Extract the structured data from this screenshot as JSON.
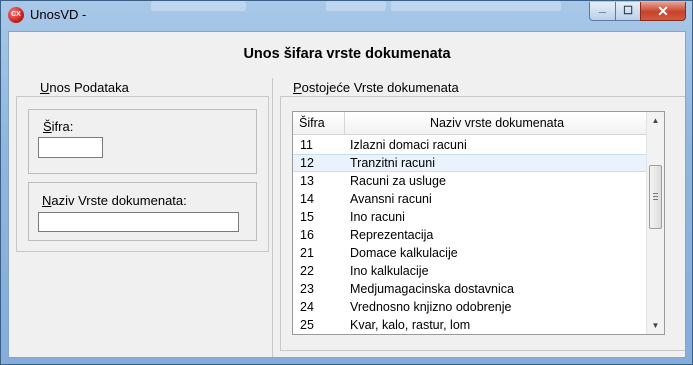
{
  "window": {
    "title": "UnosVD -",
    "icon": "cx-app-icon",
    "controls": {
      "minimize": "minimize-icon",
      "maximize": "maximize-icon",
      "close": "close-icon"
    }
  },
  "form": {
    "heading": "Unos šifara vrste dokumenata",
    "entry_group": {
      "legend_first": "U",
      "legend_rest": "nos Podataka",
      "sifra_label_first": "Š",
      "sifra_label_rest": "ifra:",
      "sifra_value": "",
      "naziv_label_first": "N",
      "naziv_label_rest": "aziv Vrste dokumenata:",
      "naziv_value": ""
    },
    "list_group": {
      "legend_first": "P",
      "legend_rest": "ostojeće Vrste dokumenata",
      "columns": [
        "Šifra",
        "Naziv vrste dokumenata"
      ],
      "rows": [
        {
          "code": "11",
          "name": "Izlazni domaci racuni"
        },
        {
          "code": "12",
          "name": "Tranzitni racuni"
        },
        {
          "code": "13",
          "name": "Racuni za usluge"
        },
        {
          "code": "14",
          "name": "Avansni racuni"
        },
        {
          "code": "15",
          "name": "Ino racuni"
        },
        {
          "code": "16",
          "name": "Reprezentacija"
        },
        {
          "code": "21",
          "name": "Domace kalkulacije"
        },
        {
          "code": "22",
          "name": "Ino kalkulacije"
        },
        {
          "code": "23",
          "name": "Medjumagacinska dostavnica"
        },
        {
          "code": "24",
          "name": "Vrednosno knjizno odobrenje"
        },
        {
          "code": "25",
          "name": "Kvar, kalo, rastur, lom"
        }
      ],
      "selected_row_index": 1
    }
  },
  "colors": {
    "titlebar": "#8fb6de",
    "close_button": "#c7432a",
    "client_bg": "#f0f0f0",
    "selection": "#eaf3fb"
  }
}
